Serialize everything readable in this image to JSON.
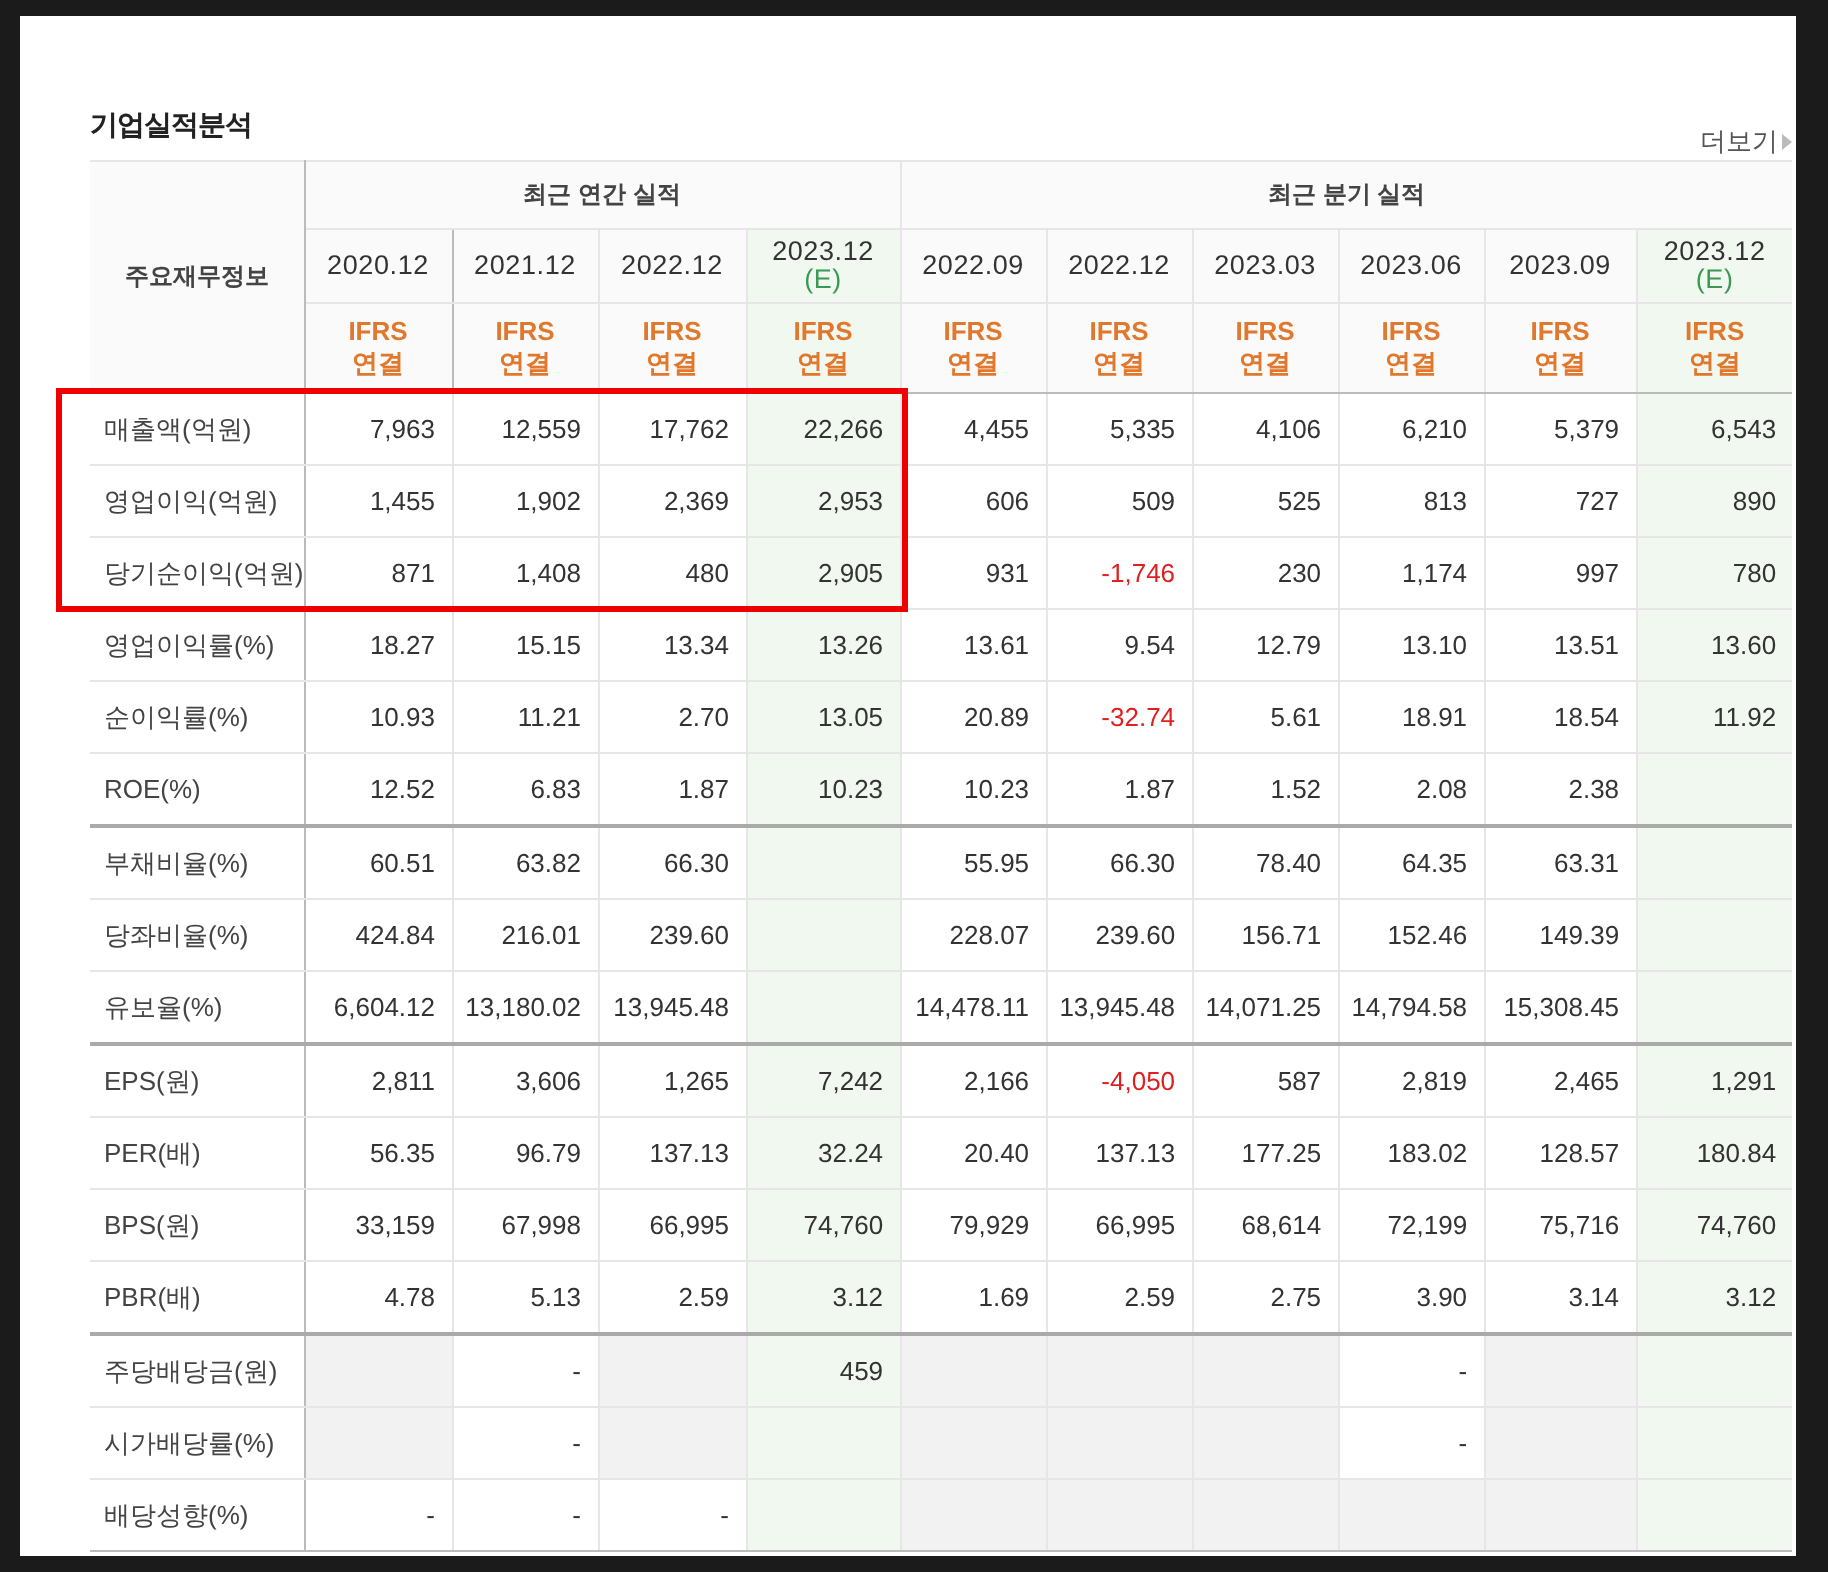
{
  "title": "기업실적분석",
  "more_link": "더보기",
  "row_header": "주요재무정보",
  "groups": [
    {
      "label": "최근 연간 실적",
      "columns": [
        {
          "period": "2020.12",
          "basis": "IFRS",
          "scope": "연결"
        },
        {
          "period": "2021.12",
          "basis": "IFRS",
          "scope": "연결"
        },
        {
          "period": "2022.12",
          "basis": "IFRS",
          "scope": "연결"
        },
        {
          "period": "2023.12",
          "estimate_mark": "(E)",
          "basis": "IFRS",
          "scope": "연결"
        }
      ]
    },
    {
      "label": "최근 분기 실적",
      "columns": [
        {
          "period": "2022.09",
          "basis": "IFRS",
          "scope": "연결"
        },
        {
          "period": "2022.12",
          "basis": "IFRS",
          "scope": "연결"
        },
        {
          "period": "2023.03",
          "basis": "IFRS",
          "scope": "연결"
        },
        {
          "period": "2023.06",
          "basis": "IFRS",
          "scope": "연결"
        },
        {
          "period": "2023.09",
          "basis": "IFRS",
          "scope": "연결"
        },
        {
          "period": "2023.12",
          "estimate_mark": "(E)",
          "basis": "IFRS",
          "scope": "연결"
        }
      ]
    }
  ],
  "rows": [
    {
      "label": "매출액(억원)",
      "boxed": true,
      "divider": false,
      "cells": [
        {
          "text": "7,963",
          "negative": false
        },
        {
          "text": "12,559",
          "negative": false
        },
        {
          "text": "17,762",
          "negative": false
        },
        {
          "text": "22,266",
          "negative": false
        },
        {
          "text": "4,455",
          "negative": false
        },
        {
          "text": "5,335",
          "negative": false
        },
        {
          "text": "4,106",
          "negative": false
        },
        {
          "text": "6,210",
          "negative": false
        },
        {
          "text": "5,379",
          "negative": false
        },
        {
          "text": "6,543",
          "negative": false
        }
      ]
    },
    {
      "label": "영업이익(억원)",
      "boxed": true,
      "divider": false,
      "cells": [
        {
          "text": "1,455",
          "negative": false
        },
        {
          "text": "1,902",
          "negative": false
        },
        {
          "text": "2,369",
          "negative": false
        },
        {
          "text": "2,953",
          "negative": false
        },
        {
          "text": "606",
          "negative": false
        },
        {
          "text": "509",
          "negative": false
        },
        {
          "text": "525",
          "negative": false
        },
        {
          "text": "813",
          "negative": false
        },
        {
          "text": "727",
          "negative": false
        },
        {
          "text": "890",
          "negative": false
        }
      ]
    },
    {
      "label": "당기순이익(억원)",
      "boxed": true,
      "divider": false,
      "cells": [
        {
          "text": "871",
          "negative": false
        },
        {
          "text": "1,408",
          "negative": false
        },
        {
          "text": "480",
          "negative": false
        },
        {
          "text": "2,905",
          "negative": false
        },
        {
          "text": "931",
          "negative": false
        },
        {
          "text": "-1,746",
          "negative": true
        },
        {
          "text": "230",
          "negative": false
        },
        {
          "text": "1,174",
          "negative": false
        },
        {
          "text": "997",
          "negative": false
        },
        {
          "text": "780",
          "negative": false
        }
      ]
    },
    {
      "label": "영업이익률(%)",
      "boxed": false,
      "divider": false,
      "cells": [
        {
          "text": "18.27",
          "negative": false
        },
        {
          "text": "15.15",
          "negative": false
        },
        {
          "text": "13.34",
          "negative": false
        },
        {
          "text": "13.26",
          "negative": false
        },
        {
          "text": "13.61",
          "negative": false
        },
        {
          "text": "9.54",
          "negative": false
        },
        {
          "text": "12.79",
          "negative": false
        },
        {
          "text": "13.10",
          "negative": false
        },
        {
          "text": "13.51",
          "negative": false
        },
        {
          "text": "13.60",
          "negative": false
        }
      ]
    },
    {
      "label": "순이익률(%)",
      "boxed": false,
      "divider": false,
      "cells": [
        {
          "text": "10.93",
          "negative": false
        },
        {
          "text": "11.21",
          "negative": false
        },
        {
          "text": "2.70",
          "negative": false
        },
        {
          "text": "13.05",
          "negative": false
        },
        {
          "text": "20.89",
          "negative": false
        },
        {
          "text": "-32.74",
          "negative": true
        },
        {
          "text": "5.61",
          "negative": false
        },
        {
          "text": "18.91",
          "negative": false
        },
        {
          "text": "18.54",
          "negative": false
        },
        {
          "text": "11.92",
          "negative": false
        }
      ]
    },
    {
      "label": "ROE(%)",
      "boxed": false,
      "divider": false,
      "cells": [
        {
          "text": "12.52",
          "negative": false
        },
        {
          "text": "6.83",
          "negative": false
        },
        {
          "text": "1.87",
          "negative": false
        },
        {
          "text": "10.23",
          "negative": false
        },
        {
          "text": "10.23",
          "negative": false
        },
        {
          "text": "1.87",
          "negative": false
        },
        {
          "text": "1.52",
          "negative": false
        },
        {
          "text": "2.08",
          "negative": false
        },
        {
          "text": "2.38",
          "negative": false
        },
        {
          "shaded": false
        }
      ]
    },
    {
      "label": "부채비율(%)",
      "boxed": false,
      "divider": true,
      "cells": [
        {
          "text": "60.51",
          "negative": false
        },
        {
          "text": "63.82",
          "negative": false
        },
        {
          "text": "66.30",
          "negative": false
        },
        {
          "shaded": false
        },
        {
          "text": "55.95",
          "negative": false
        },
        {
          "text": "66.30",
          "negative": false
        },
        {
          "text": "78.40",
          "negative": false
        },
        {
          "text": "64.35",
          "negative": false
        },
        {
          "text": "63.31",
          "negative": false
        },
        {
          "shaded": false
        }
      ]
    },
    {
      "label": "당좌비율(%)",
      "boxed": false,
      "divider": false,
      "cells": [
        {
          "text": "424.84",
          "negative": false
        },
        {
          "text": "216.01",
          "negative": false
        },
        {
          "text": "239.60",
          "negative": false
        },
        {
          "shaded": false
        },
        {
          "text": "228.07",
          "negative": false
        },
        {
          "text": "239.60",
          "negative": false
        },
        {
          "text": "156.71",
          "negative": false
        },
        {
          "text": "152.46",
          "negative": false
        },
        {
          "text": "149.39",
          "negative": false
        },
        {
          "shaded": false
        }
      ]
    },
    {
      "label": "유보율(%)",
      "boxed": false,
      "divider": false,
      "cells": [
        {
          "text": "6,604.12",
          "negative": false
        },
        {
          "text": "13,180.02",
          "negative": false
        },
        {
          "text": "13,945.48",
          "negative": false
        },
        {
          "shaded": false
        },
        {
          "text": "14,478.11",
          "negative": false
        },
        {
          "text": "13,945.48",
          "negative": false
        },
        {
          "text": "14,071.25",
          "negative": false
        },
        {
          "text": "14,794.58",
          "negative": false
        },
        {
          "text": "15,308.45",
          "negative": false
        },
        {
          "shaded": false
        }
      ]
    },
    {
      "label": "EPS(원)",
      "boxed": false,
      "divider": true,
      "cells": [
        {
          "text": "2,811",
          "negative": false
        },
        {
          "text": "3,606",
          "negative": false
        },
        {
          "text": "1,265",
          "negative": false
        },
        {
          "text": "7,242",
          "negative": false
        },
        {
          "text": "2,166",
          "negative": false
        },
        {
          "text": "-4,050",
          "negative": true
        },
        {
          "text": "587",
          "negative": false
        },
        {
          "text": "2,819",
          "negative": false
        },
        {
          "text": "2,465",
          "negative": false
        },
        {
          "text": "1,291",
          "negative": false
        }
      ]
    },
    {
      "label": "PER(배)",
      "boxed": false,
      "divider": false,
      "cells": [
        {
          "text": "56.35",
          "negative": false
        },
        {
          "text": "96.79",
          "negative": false
        },
        {
          "text": "137.13",
          "negative": false
        },
        {
          "text": "32.24",
          "negative": false
        },
        {
          "text": "20.40",
          "negative": false
        },
        {
          "text": "137.13",
          "negative": false
        },
        {
          "text": "177.25",
          "negative": false
        },
        {
          "text": "183.02",
          "negative": false
        },
        {
          "text": "128.57",
          "negative": false
        },
        {
          "text": "180.84",
          "negative": false
        }
      ]
    },
    {
      "label": "BPS(원)",
      "boxed": false,
      "divider": false,
      "cells": [
        {
          "text": "33,159",
          "negative": false
        },
        {
          "text": "67,998",
          "negative": false
        },
        {
          "text": "66,995",
          "negative": false
        },
        {
          "text": "74,760",
          "negative": false
        },
        {
          "text": "79,929",
          "negative": false
        },
        {
          "text": "66,995",
          "negative": false
        },
        {
          "text": "68,614",
          "negative": false
        },
        {
          "text": "72,199",
          "negative": false
        },
        {
          "text": "75,716",
          "negative": false
        },
        {
          "text": "74,760",
          "negative": false
        }
      ]
    },
    {
      "label": "PBR(배)",
      "boxed": false,
      "divider": false,
      "cells": [
        {
          "text": "4.78",
          "negative": false
        },
        {
          "text": "5.13",
          "negative": false
        },
        {
          "text": "2.59",
          "negative": false
        },
        {
          "text": "3.12",
          "negative": false
        },
        {
          "text": "1.69",
          "negative": false
        },
        {
          "text": "2.59",
          "negative": false
        },
        {
          "text": "2.75",
          "negative": false
        },
        {
          "text": "3.90",
          "negative": false
        },
        {
          "text": "3.14",
          "negative": false
        },
        {
          "text": "3.12",
          "negative": false
        }
      ]
    },
    {
      "label": "주당배당금(원)",
      "boxed": false,
      "divider": true,
      "cells": [
        {
          "shaded": true
        },
        {
          "text": "-",
          "negative": false
        },
        {
          "shaded": true
        },
        {
          "text": "459",
          "negative": false
        },
        {
          "shaded": true
        },
        {
          "shaded": true
        },
        {
          "shaded": true
        },
        {
          "text": "-",
          "negative": false
        },
        {
          "shaded": true
        },
        {
          "shaded": false
        }
      ]
    },
    {
      "label": "시가배당률(%)",
      "boxed": false,
      "divider": false,
      "cells": [
        {
          "shaded": true
        },
        {
          "text": "-",
          "negative": false
        },
        {
          "shaded": true
        },
        {
          "shaded": false
        },
        {
          "shaded": true
        },
        {
          "shaded": true
        },
        {
          "shaded": true
        },
        {
          "text": "-",
          "negative": false
        },
        {
          "shaded": true
        },
        {
          "shaded": false
        }
      ]
    },
    {
      "label": "배당성향(%)",
      "boxed": false,
      "divider": false,
      "cells": [
        {
          "text": "-",
          "negative": false
        },
        {
          "text": "-",
          "negative": false
        },
        {
          "text": "-",
          "negative": false
        },
        {
          "shaded": false
        },
        {
          "shaded": true
        },
        {
          "shaded": true
        },
        {
          "shaded": true
        },
        {
          "shaded": true
        },
        {
          "shaded": true
        },
        {
          "shaded": false
        }
      ]
    }
  ]
}
